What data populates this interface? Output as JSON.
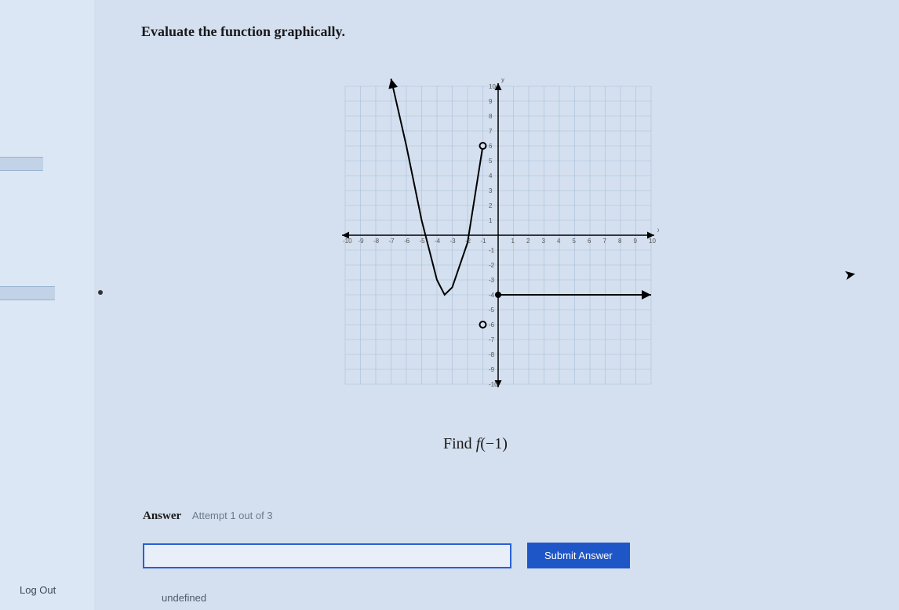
{
  "instruction": "Evaluate the function graphically.",
  "question_prefix": "Find ",
  "question_func": "f",
  "question_arg": "(−1)",
  "answer_label": "Answer",
  "attempt_text": "Attempt 1 out of 3",
  "submit_label": "Submit Answer",
  "undefined_label": "undefined",
  "logout_label": "Log Out",
  "answer_value": "",
  "chart_data": {
    "type": "line",
    "title": "",
    "xlabel": "x",
    "ylabel": "y",
    "xlim": [
      -10,
      10
    ],
    "ylim": [
      -10,
      10
    ],
    "xticks": [
      -10,
      -9,
      -8,
      -7,
      -6,
      -5,
      -4,
      -3,
      -2,
      -1,
      1,
      2,
      3,
      4,
      5,
      6,
      7,
      8,
      9,
      10
    ],
    "yticks": [
      -10,
      -9,
      -8,
      -7,
      -6,
      -5,
      -4,
      -3,
      -2,
      -1,
      1,
      2,
      3,
      4,
      5,
      6,
      7,
      8,
      9,
      10
    ],
    "grid": true,
    "series": [
      {
        "name": "piece1_curve",
        "kind": "curve",
        "x": [
          -7,
          -6,
          -5,
          -4,
          -3.5,
          -3,
          -2,
          -1
        ],
        "values": [
          10.5,
          6,
          1,
          -3,
          -4,
          -3.5,
          -0.5,
          6
        ],
        "left_end": "arrow",
        "right_end": "open"
      },
      {
        "name": "piece2_point",
        "kind": "point",
        "x": [
          -1
        ],
        "values": [
          -6
        ],
        "style": "open"
      },
      {
        "name": "piece3_ray",
        "kind": "line",
        "x": [
          0,
          10
        ],
        "values": [
          -4,
          -4
        ],
        "left_end": "closed",
        "right_end": "arrow"
      }
    ]
  }
}
